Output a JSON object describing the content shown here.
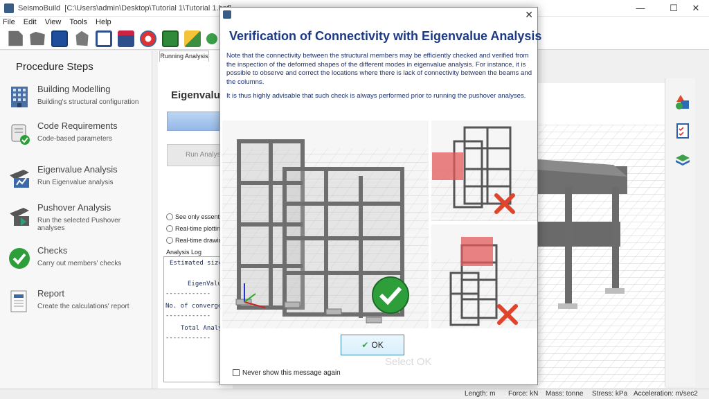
{
  "window": {
    "app": "SeismoBuild",
    "path": "[C:\\Users\\admin\\Desktop\\Tutorial 1\\Tutorial 1.bpf]",
    "minimize": "—",
    "maximize": "☐",
    "close": "✕"
  },
  "menu": [
    "File",
    "Edit",
    "View",
    "Tools",
    "Help"
  ],
  "sidebar": {
    "title": "Procedure Steps",
    "steps": [
      {
        "name": "Building Modelling",
        "desc": "Building's structural configuration",
        "icon": "building-icon"
      },
      {
        "name": "Code Requirements",
        "desc": "Code-based parameters",
        "icon": "scroll-check-icon"
      },
      {
        "name": "Eigenvalue Analysis",
        "desc": "Run Eigenvalue analysis",
        "icon": "eigenvalue-icon"
      },
      {
        "name": "Pushover Analysis",
        "desc": "Run the selected Pushover analyses",
        "icon": "pushover-icon"
      },
      {
        "name": "Checks",
        "desc": "Carry out members' checks",
        "icon": "green-check-icon"
      },
      {
        "name": "Report",
        "desc": "Create the calculations' report",
        "icon": "report-icon"
      }
    ]
  },
  "center": {
    "tab": "Running Analysis",
    "heading": "Eigenvalue",
    "run_button": "Run Analysi",
    "radios": [
      "See only essential",
      "Real-time plotting",
      "Real-time drawing"
    ],
    "log_title": "Analysis Log",
    "log_lines": [
      "Estimated size",
      "EigenValu",
      "------------",
      "No. of converge",
      "------------",
      "Total Analy",
      "------------"
    ]
  },
  "dialog": {
    "title": "Verification of Connectivity with Eigenvalue Analysis",
    "para1": "Note that the connectivity between the structural members may be efficiently checked and verified from the inspection of the deformed shapes of the different modes in eigenvalue analysis. For instance, it is possible to observe and correct the locations where there is lack of connectivity between the beams and the columns.",
    "para2": "It is thus highly advisable that such check is always performed prior to running the pushover analyses.",
    "ok_label": "OK",
    "never_show": "Never show this message again",
    "close": "✕"
  },
  "overlay_text": "Select OK",
  "status": {
    "length": "Length: m",
    "force": "Force: kN",
    "mass": "Mass: tonne",
    "stress": "Stress: kPa",
    "accel": "Acceleration: m/sec2"
  },
  "colors": {
    "title_blue": "#1c3a83",
    "check_green": "#2e9e3a",
    "error_red": "#e0452b"
  }
}
